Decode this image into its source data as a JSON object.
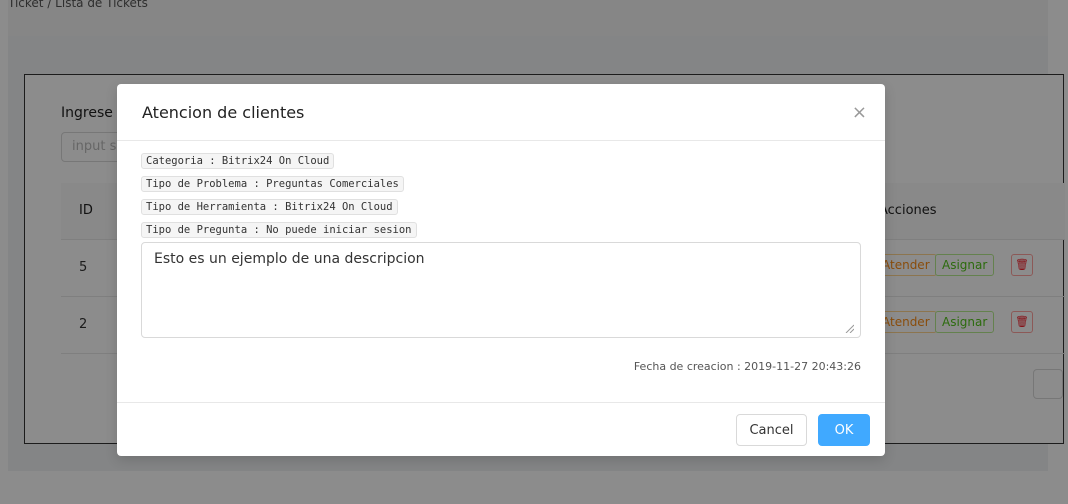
{
  "breadcrumb": "Ticket / Lista de Tickets",
  "page": {
    "search_label": "Ingrese el numero de ticket",
    "search_placeholder": "input search text",
    "table": {
      "col_id": "ID",
      "col_actions": "Acciones",
      "rows": [
        {
          "id": "5",
          "atender": "Atender",
          "asignar": "Asignar"
        },
        {
          "id": "2",
          "atender": "Atender",
          "asignar": "Asignar"
        }
      ]
    }
  },
  "modal": {
    "title": "Atencion de clientes",
    "close": "×",
    "tags": [
      "Categoria : Bitrix24 On Cloud",
      "Tipo de Problema : Preguntas Comerciales",
      "Tipo de Herramienta : Bitrix24 On Cloud",
      "Tipo de Pregunta : No puede iniciar sesion"
    ],
    "description": "Esto es un ejemplo de una descripcion",
    "fecha": "Fecha de creacion : 2019-11-27 20:43:26",
    "cancel_label": "Cancel",
    "ok_label": "OK"
  },
  "colors": {
    "primary": "#40a9ff",
    "atender": "#fa8c16",
    "asignar": "#52c41a",
    "delete": "#f5222d"
  }
}
